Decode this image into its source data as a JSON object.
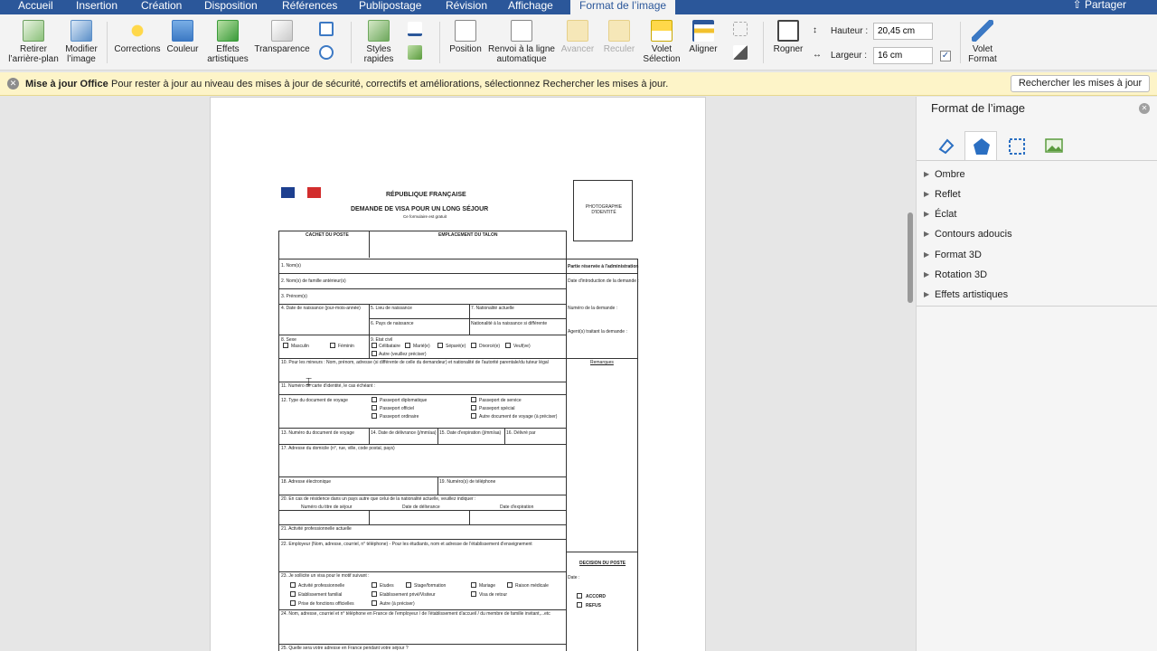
{
  "tabs": [
    "Accueil",
    "Insertion",
    "Création",
    "Disposition",
    "Références",
    "Publipostage",
    "Révision",
    "Affichage",
    "Format de l’image"
  ],
  "share_label": "Partager",
  "ribbon": {
    "remove_bg": "Retirer l’arrière-plan",
    "edit_image": "Modifier l’image",
    "corrections": "Corrections",
    "color": "Couleur",
    "artistic": "Effets artistiques",
    "transparency": "Transparence",
    "quick_styles": "Styles rapides",
    "position": "Position",
    "wrap": "Renvoi à la ligne automatique",
    "forward": "Avancer",
    "backward": "Reculer",
    "selection_pane": "Volet Sélection",
    "align": "Aligner",
    "crop": "Rogner",
    "height_label": "Hauteur :",
    "height_value": "20,45 cm",
    "width_label": "Largeur :",
    "width_value": "16 cm",
    "format_pane": "Volet Format"
  },
  "infobar": {
    "title": "Mise à jour Office",
    "message": "Pour rester à jour au niveau des mises à jour de sécurité, correctifs et améliorations, sélectionnez Rechercher les mises à jour.",
    "button": "Rechercher les mises à jour"
  },
  "form": {
    "republic": "RÉPUBLIQUE FRANÇAISE",
    "title": "DEMANDE DE VISA POUR UN LONG SÉJOUR",
    "free": "Ce formulaire est gratuit",
    "photo": "PHOTOGRAPHIE D'IDENTITÉ",
    "stamp": "CACHET DU POSTE",
    "talon": "EMPLACEMENT DU TALON",
    "admin": "Partie réservée à l'administration",
    "f1": "1. Nom(s)",
    "f2": "2. Nom(s) de famille antérieur(s)",
    "f3": "3. Prénom(s)",
    "f4": "4. Date de naissance (jour-mois-année)",
    "f5": "5. Lieu de naissance",
    "f6": "6. Pays de naissance",
    "f7": "7. Nationalité actuelle",
    "f7b": "Nationalité à la naissance si différente",
    "f8": "8. Sexe",
    "male": "Masculin",
    "female": "Féminin",
    "f9": "9. Etat civil",
    "single": "Célibataire",
    "married": "Marié(e)",
    "separated": "Séparé(e)",
    "divorced": "Divorcé(e)",
    "widow": "Veuf(ve)",
    "other_status": "Autre (veuillez préciser)",
    "f10": "10. Pour les mineurs : Nom, prénom, adresse (si différente de celle du demandeur) et nationalité de l'autorité parentale/du tuteur légal",
    "f11": "11. Numéro de carte d'identité, le cas échéant :",
    "f12": "12. Type du document de voyage",
    "diplomatic": "Passeport diplomatique",
    "official": "Passeport officiel",
    "ordinary": "Passeport ordinaire",
    "service": "Passeport de service",
    "special": "Passeport spécial",
    "other_doc": "Autre document de voyage (à préciser)",
    "f13": "13. Numéro du document de voyage",
    "f14": "14. Date de délivrance (j/mm/aa)",
    "f15": "15. Date d'expiration (j/mm/aa)",
    "f16": "16. Délivré par",
    "f17": "17. Adresse du domicile (n°, rue, ville, code postal, pays)",
    "f18": "18. Adresse électronique",
    "f19": "19. Numéro(s) de téléphone",
    "f20": "20. En cas de résidence dans un pays autre que celui de la nationalité actuelle, veuillez indiquer :",
    "permit": "Numéro du titre de séjour",
    "delivery": "Date de délivrance",
    "expiry": "Date d'expiration",
    "f21": "21. Activité professionnelle actuelle",
    "f22": "22. Employeur (Nom, adresse, courriel, n° téléphone) - Pour les étudiants, nom et adresse de l'établissement d'enseignement",
    "f23": "23. Je sollicite un visa pour le motif suivant :",
    "pro": "Activité professionnelle",
    "family": "Etablissement familial",
    "duty": "Prise de fonctions officielles",
    "studies": "Etudes",
    "private": "Etablissement privé/Visiteur",
    "other_reason": "Autre (à préciser)",
    "internship": "Stage/formation",
    "marriage": "Mariage",
    "return": "Visa de retour",
    "medical": "Raison médicale",
    "f24": "24. Nom, adresse, courriel et n° téléphone en France de l'employeur / de l'établissement d'accueil / du membre de famille invitant,...etc",
    "f25": "25. Quelle sera votre adresse en France pendant votre séjour ?",
    "date_intro": "Date d'introduction de la demande :",
    "app_number": "Numéro de la demande :",
    "agent": "Agent(s) traitant la demande :",
    "remarks": "Remarques",
    "decision": "DECISION DU POSTE",
    "date": "Date :",
    "accord": "ACCORD",
    "refus": "REFUS"
  },
  "panel": {
    "title": "Format de l’image",
    "sections": [
      "Ombre",
      "Reflet",
      "Éclat",
      "Contours adoucis",
      "Format 3D",
      "Rotation 3D",
      "Effets artistiques"
    ]
  }
}
